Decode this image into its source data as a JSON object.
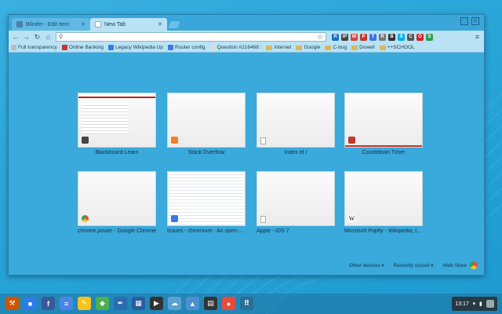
{
  "tabs": [
    {
      "label": "Blinder - Edit Item",
      "active": false,
      "favicon_color": "#4a7fa8"
    },
    {
      "label": "New Tab",
      "active": true,
      "favicon_color": "#ffffff"
    }
  ],
  "omnibox": {
    "value": "",
    "placeholder": ""
  },
  "extensions": [
    {
      "name": "ext-rss-icon",
      "color": "#1a6fbf",
      "glyph": "R"
    },
    {
      "name": "ext-ip-icon",
      "color": "#444444",
      "glyph": "IP"
    },
    {
      "name": "ext-gmail-icon",
      "color": "#d44638",
      "glyph": "M"
    },
    {
      "name": "ext-pin-icon",
      "color": "#c0392b",
      "glyph": "P"
    },
    {
      "name": "ext-translate-icon",
      "color": "#3b78e7",
      "glyph": "T"
    },
    {
      "name": "ext-reader-icon",
      "color": "#777777",
      "glyph": "R"
    },
    {
      "name": "ext-bug-icon",
      "color": "#333333",
      "glyph": "B"
    },
    {
      "name": "ext-skype-icon",
      "color": "#00aff0",
      "glyph": "S"
    },
    {
      "name": "ext-camera-icon",
      "color": "#555555",
      "glyph": "C"
    },
    {
      "name": "ext-opera-icon",
      "color": "#d81e2a",
      "glyph": "O"
    },
    {
      "name": "ext-shield-icon",
      "color": "#2e9e4f",
      "glyph": "S"
    }
  ],
  "bookmarks": [
    {
      "label": "Full transparency",
      "type": "page",
      "color": "#bbbbbb"
    },
    {
      "label": "Online Banking",
      "type": "page",
      "color": "#c0392b"
    },
    {
      "label": "Legacy Wikipedia Up",
      "type": "page",
      "color": "#3b78e7"
    },
    {
      "label": "Router config",
      "type": "page",
      "color": "#3b78e7"
    },
    {
      "label": "Question #216468 :",
      "type": "page",
      "color": "#dddddd"
    },
    {
      "label": "Internet",
      "type": "folder"
    },
    {
      "label": "Google",
      "type": "folder"
    },
    {
      "label": "C-bug",
      "type": "folder"
    },
    {
      "label": "Dowell",
      "type": "folder"
    },
    {
      "label": "++SCHOOL",
      "type": "folder"
    }
  ],
  "most_visited": [
    {
      "label": "Blackboard Learn",
      "icon": "#444444"
    },
    {
      "label": "Stack Overflow",
      "icon": "#f48024"
    },
    {
      "label": "Index of /",
      "icon": "page"
    },
    {
      "label": "Countdown Timer",
      "icon": "#c0392b"
    },
    {
      "label": "chrome.power - Google Chrome",
      "icon": "chrome"
    },
    {
      "label": "Issues - chromium - An open-...",
      "icon": "#3b78e7"
    },
    {
      "label": "Apple - iOS 7",
      "icon": "page"
    },
    {
      "label": "Microsoft Popfly - Wikipedia, t...",
      "icon": "W"
    }
  ],
  "footer": {
    "other_devices": "Other devices",
    "recently_closed": "Recently closed",
    "web_store": "Web Store"
  },
  "shelf": {
    "apps": [
      {
        "name": "toolbox-app-icon",
        "color": "#d35400",
        "glyph": "⚒"
      },
      {
        "name": "files-app-icon",
        "color": "#2d7be5",
        "glyph": "■"
      },
      {
        "name": "facebook-app-icon",
        "color": "#3b5998",
        "glyph": "f"
      },
      {
        "name": "docs-app-icon",
        "color": "#4a86e8",
        "glyph": "≡"
      },
      {
        "name": "keep-app-icon",
        "color": "#f7c21a",
        "glyph": "✎"
      },
      {
        "name": "maps-app-icon",
        "color": "#4caf50",
        "glyph": "◆"
      },
      {
        "name": "pen-app-icon",
        "color": "#2b6cb0",
        "glyph": "✒"
      },
      {
        "name": "calculator-app-icon",
        "color": "#2c5aa0",
        "glyph": "▦"
      },
      {
        "name": "media-app-icon",
        "color": "#333333",
        "glyph": "▶"
      },
      {
        "name": "cloud-app-icon",
        "color": "#5aa0d0",
        "glyph": "☁"
      },
      {
        "name": "photos-app-icon",
        "color": "#4d8fd1",
        "glyph": "▲"
      },
      {
        "name": "film-app-icon",
        "color": "#333333",
        "glyph": "▤"
      },
      {
        "name": "chrome-app-icon",
        "color": "#e84b3c",
        "glyph": "●"
      },
      {
        "name": "app-launcher-icon",
        "color": "#2a6f95",
        "glyph": "⠿"
      }
    ],
    "time": "13:17"
  }
}
